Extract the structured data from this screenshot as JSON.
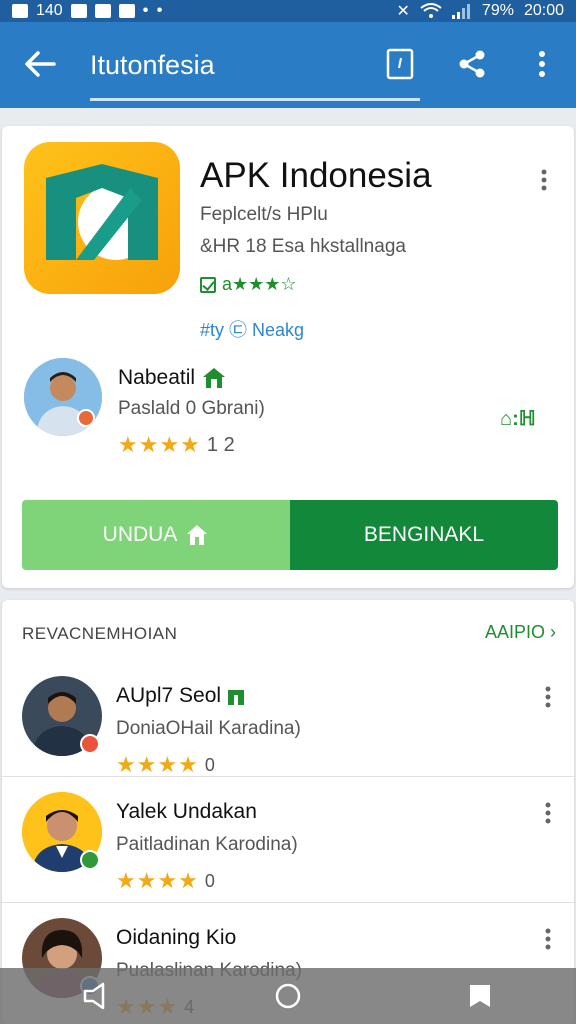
{
  "status_bar": {
    "left_text": "140",
    "battery": "79%",
    "time": "20:00"
  },
  "app_bar": {
    "title": "Itutonfesia"
  },
  "app": {
    "name": "APK Indonesia",
    "developer": "Feplcelt/s HPlu",
    "meta": "&HR 18 Esa hkstallnaga",
    "rating_text": "a★★★☆",
    "link_text": "#ty ㉢ Neakg"
  },
  "author": {
    "name": "Nabeatil",
    "subtitle": "Paslald 0 Gbrani)",
    "stars": "★★★★",
    "count": "1 2",
    "right_text": "⌂:ℍ"
  },
  "buttons": {
    "primary_label": "UNDUA",
    "secondary_label": "BENGINAKL"
  },
  "recommend": {
    "title": "REVACNEMHOIAN",
    "more_label": "AAIPIO",
    "items": [
      {
        "name": "AUpl7 Seol",
        "subtitle": "DoniaOHail Karadina)",
        "stars": "★★★★",
        "count": "0"
      },
      {
        "name": "Yalek Undakan",
        "subtitle": "Paitladinan Karodina)",
        "stars": "★★★★",
        "count": "0"
      },
      {
        "name": "Oidaning Kio",
        "subtitle": "Pualaslinan Karodina)",
        "stars": "★★★",
        "count": "4"
      }
    ]
  },
  "colors": {
    "appbar": "#2a7cc4",
    "statusbar": "#1f5fa0",
    "accent_green": "#12893a",
    "light_green": "#7fd47a",
    "star": "#f2a917",
    "icon_bg": "#ffc21a"
  },
  "icons": [
    "back-arrow-icon",
    "bookmark-icon",
    "share-icon",
    "more-vert-icon",
    "home-icon",
    "check-icon",
    "chevron-right-icon",
    "nav-back-icon",
    "nav-home-icon",
    "nav-recents-icon"
  ]
}
